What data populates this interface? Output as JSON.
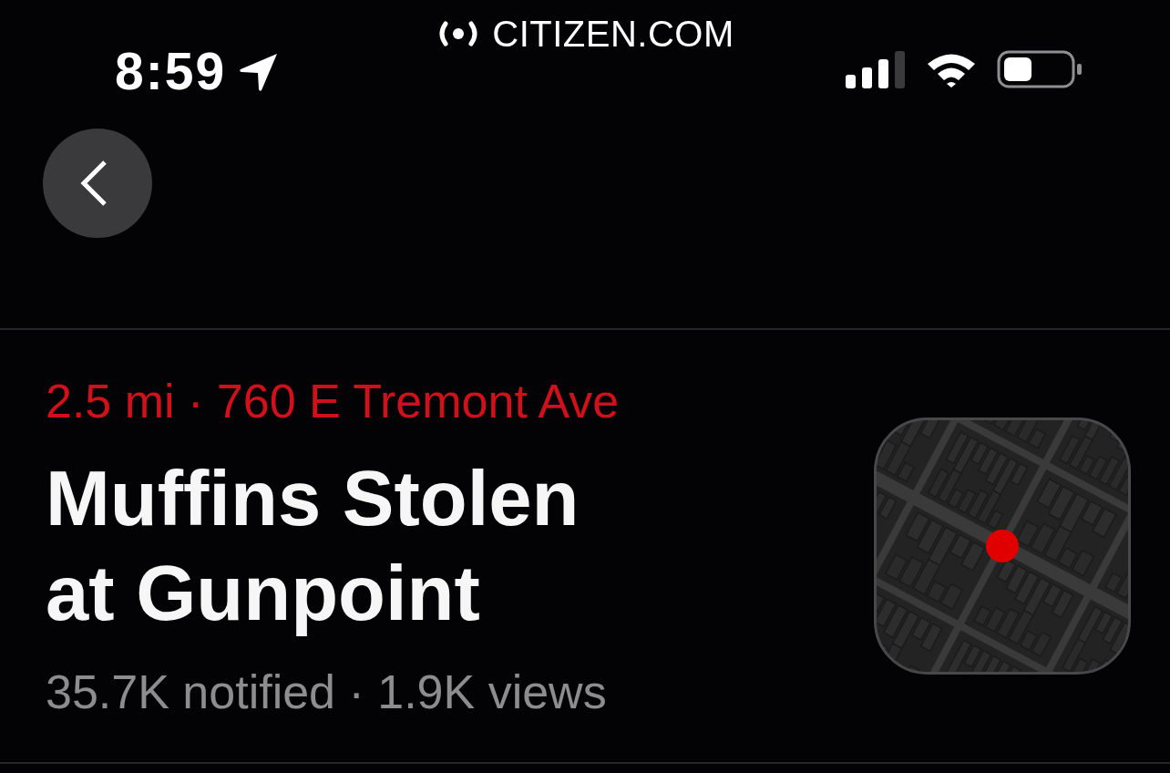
{
  "status_bar": {
    "time": "8:59",
    "site": "CITIZEN.COM"
  },
  "incident": {
    "location": "2.5 mi · 760 E Tremont Ave",
    "title": "Muffins Stolen at Gunpoint",
    "stats": "35.7K notified · 1.9K views"
  }
}
